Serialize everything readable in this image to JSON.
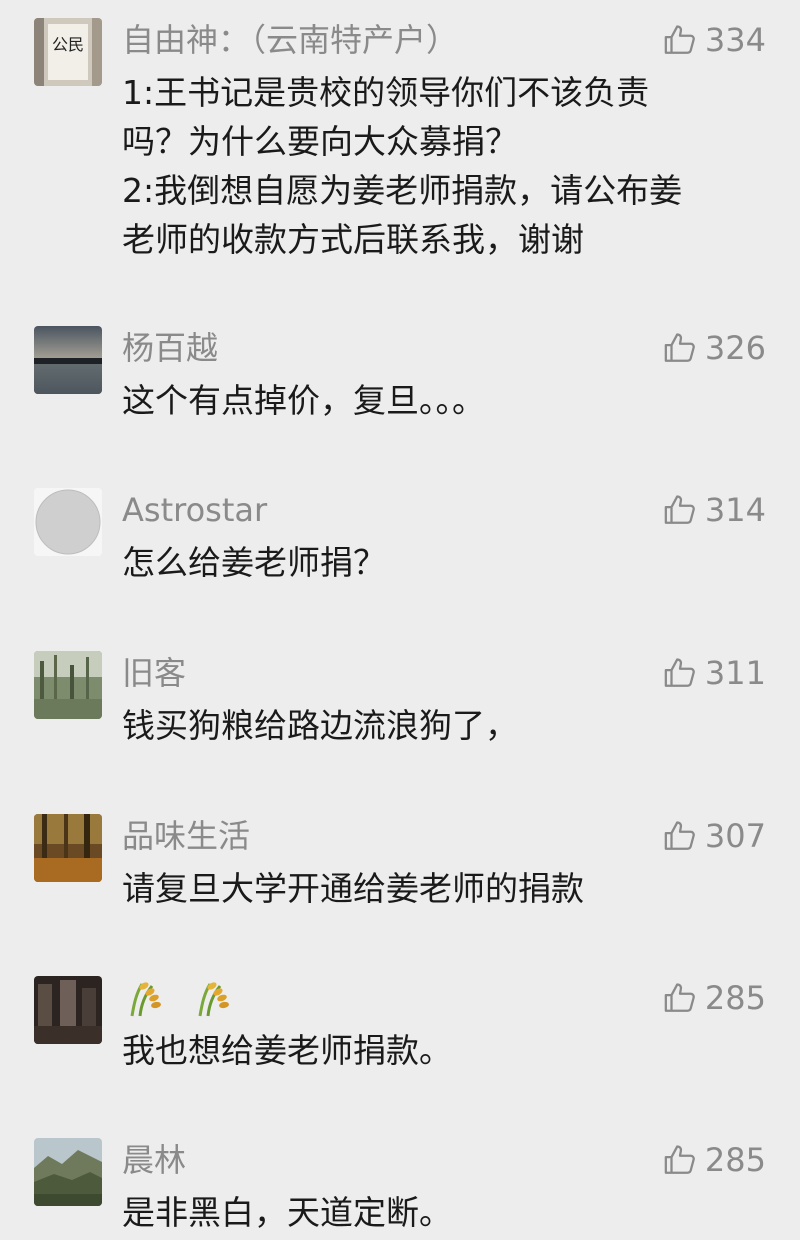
{
  "comments": [
    {
      "name": "自由神：（云南特产户）",
      "likes": "334",
      "text": "1:王书记是贵校的领导你们不该负责\n吗？为什么要向大众募捐？\n2:我倒想自愿为姜老师捐款，请公布姜\n老师的收款方式后联系我，谢谢",
      "avatar_text": "公民"
    },
    {
      "name": "杨百越",
      "likes": "326",
      "text": "这个有点掉价，复旦。。。"
    },
    {
      "name": "Astrostar",
      "likes": "314",
      "text": "怎么给姜老师捐？"
    },
    {
      "name": "旧客",
      "likes": "311",
      "text": "钱买狗粮给路边流浪狗了，"
    },
    {
      "name": "品味生活",
      "likes": "307",
      "text": "请复旦大学开通给姜老师的捐款"
    },
    {
      "name": "",
      "name_icons": [
        "rice-sprout-icon",
        "rice-sprout-icon"
      ],
      "likes": "285",
      "text": "我也想给姜老师捐款。"
    },
    {
      "name": "晨林",
      "likes": "285",
      "text": "是非黑白，天道定断。"
    }
  ],
  "icons": {
    "like": "thumbs-up-icon"
  },
  "colors": {
    "background": "#ededed",
    "name": "#8a8a8a",
    "text": "#1a1a1a"
  }
}
